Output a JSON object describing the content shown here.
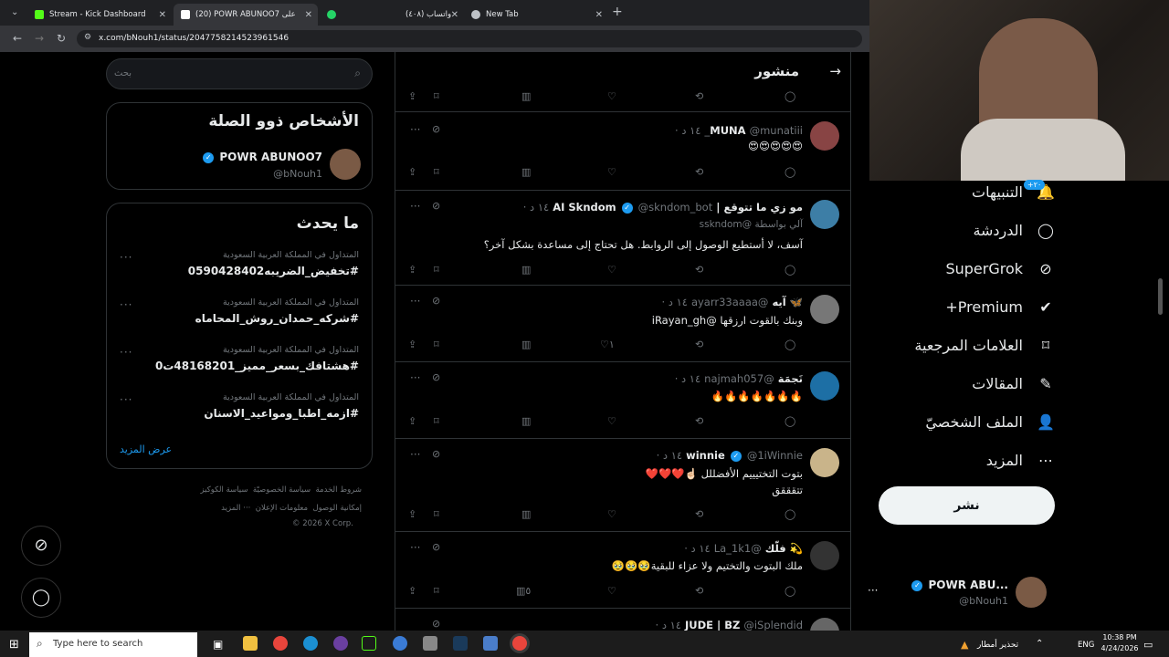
{
  "tabs": [
    {
      "label": "Stream - Kick Dashboard",
      "color": "#53fc18"
    },
    {
      "label": "(20) POWR ABUNOO7 على X: \"",
      "color": "#ffffff"
    },
    {
      "label": "واتساب (٤٠٨)",
      "color": "#25d366"
    },
    {
      "label": "New Tab",
      "color": "#bdc1c6"
    }
  ],
  "url": "x.com/bNouh1/status/2047758214523961546",
  "search": {
    "placeholder": "بحث"
  },
  "related": {
    "title": "الأشخاص ذوو الصلة",
    "name": "POWR ABUNOO7",
    "handle": "@bNouh1"
  },
  "trends": {
    "title": "ما يحدث",
    "items": [
      {
        "meta": "المتداول في المملكة العربية السعودية",
        "tag": "#تخفيض_الضريبه0590428402"
      },
      {
        "meta": "المتداول في المملكة العربية السعودية",
        "tag": "#شركه_حمدان_روش_المحاماه"
      },
      {
        "meta": "المتداول في المملكة العربية السعودية",
        "tag": "#هشتافك_بسعر_مميز_48168201ت0"
      },
      {
        "meta": "المتداول في المملكة العربية السعودية",
        "tag": "#ازمه_اطبا_ومواعيد_الاسنان"
      }
    ],
    "more": "عرض المزيد"
  },
  "footer": {
    "links1": [
      "شروط الخدمة",
      "سياسة الخصوصيّة",
      "سياسة الكوكيز"
    ],
    "links2": [
      "إمكانية الوصول",
      "معلومات الإعلان",
      "··· المزيد"
    ],
    "copyright": "© 2026 X Corp."
  },
  "feed": {
    "header": "منشور",
    "posts": [
      {
        "name": "MUNA",
        "handle": "@munatiii_",
        "time": "١٤ د ·",
        "text": "😍😍😍😍😍",
        "avatar": "#884444",
        "likes": "",
        "views": ""
      },
      {
        "name": "مو زي ما تتوقع | AI Skndom",
        "handle": "@skndom_bot",
        "time": "١٤ د ·",
        "sub": "آلي بواسطة @sskndom",
        "text": "آسف، لا أستطيع الوصول إلى الروابط. هل تحتاج إلى مساعدة بشكل آخر؟",
        "avatar": "#3d7ea6",
        "likes": "",
        "views": ""
      },
      {
        "name": "🦋 آيه",
        "handle": "@ayarr33aaaa",
        "time": "١٤ د ·",
        "text": "وبنك بالقوت ارزقها @iRayan_gh",
        "avatar": "#777",
        "likes": "١",
        "views": ""
      },
      {
        "name": "نَجمَة",
        "handle": "@najmah057",
        "time": "١٤ د ·",
        "text": "🔥🔥🔥🔥🔥🔥🔥",
        "avatar": "#1d6fa5",
        "likes": "",
        "views": ""
      },
      {
        "name": "winnie",
        "handle": "@1iWinnie",
        "time": "١٤ د ·",
        "text": "بتوت التختيييم الأفضللل ☝🏻❤️❤️❤️",
        "text2": "تتقققق",
        "avatar": "#c9b48a",
        "likes": "",
        "views": ""
      },
      {
        "name": "💫 فلّك",
        "handle": "@La_1k1",
        "time": "١٤ د ·",
        "text": "ملك البتوت والتختيم ولا عزاء للبقية🥹🥹🥹",
        "avatar": "#333",
        "likes": "",
        "views": "٥"
      },
      {
        "name": "JUDE | BZ",
        "handle": "@iSplendid",
        "time": "١٤ د ·",
        "text": "",
        "avatar": "#666",
        "likes": "",
        "views": ""
      }
    ]
  },
  "nav": [
    {
      "label": "التنبيهات",
      "icon": "🔔",
      "badge": "+٢٠"
    },
    {
      "label": "الدردشة",
      "icon": "💬"
    },
    {
      "label": "SuperGrok",
      "icon": "⊘"
    },
    {
      "label": "Premium+",
      "icon": "✔"
    },
    {
      "label": "العلامات المرجعية",
      "icon": "🔖"
    },
    {
      "label": "المقالات",
      "icon": "📝"
    },
    {
      "label": "الملف الشخصيّ",
      "icon": "👤"
    },
    {
      "label": "المزيد",
      "icon": "⋯"
    }
  ],
  "post_button": "نشر",
  "account": {
    "name": "POWR ABU...",
    "handle": "@bNouh1"
  },
  "taskbar": {
    "search_placeholder": "Type here to search",
    "weather": "تحذير أمطار",
    "lang": "ENG",
    "time": "10:38 PM",
    "date": "4/24/2026"
  }
}
